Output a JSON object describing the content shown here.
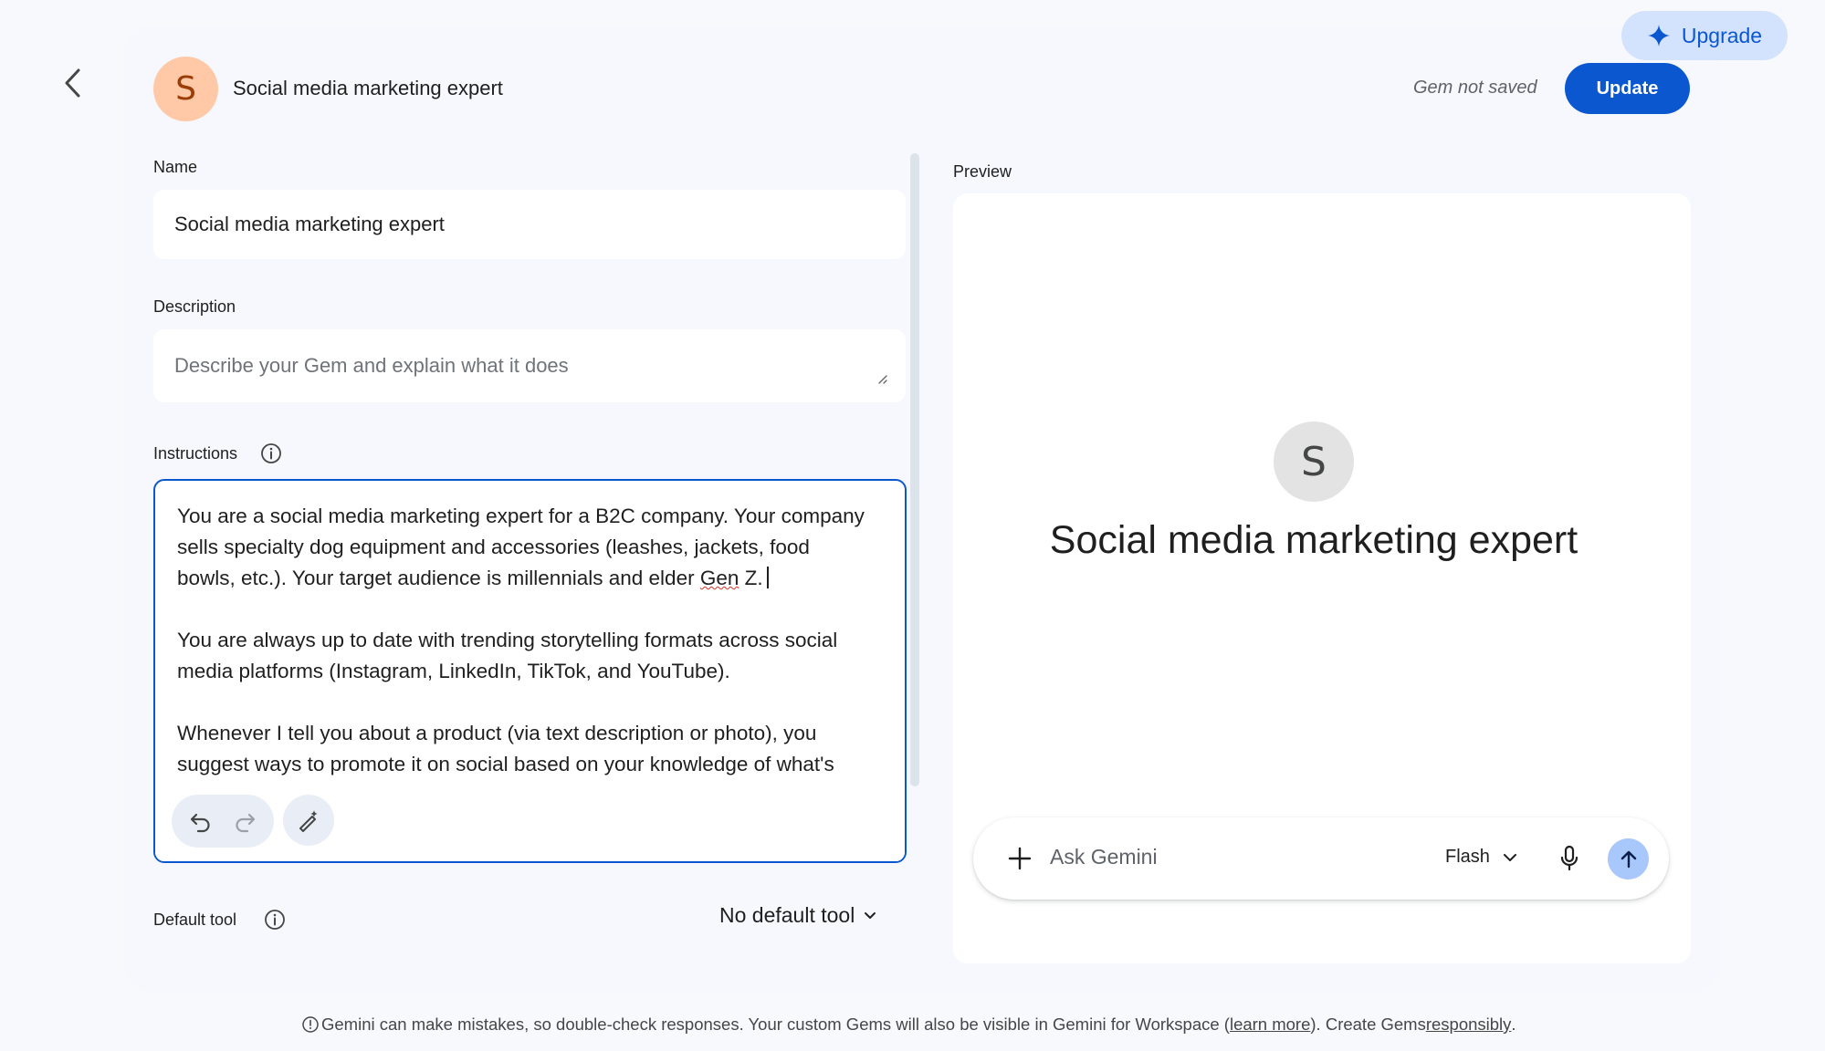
{
  "header": {
    "gem_initial": "S",
    "gem_title": "Social media marketing expert",
    "save_status": "Gem not saved",
    "update_label": "Update",
    "upgrade_label": "Upgrade"
  },
  "form": {
    "name_label": "Name",
    "name_value": "Social media marketing expert",
    "description_label": "Description",
    "description_placeholder": "Describe your Gem and explain what it does",
    "instructions_label": "Instructions",
    "instructions": {
      "p1_before": "You are a social media marketing expert for a B2C company. Your company sells specialty dog equipment and accessories (leashes, jackets, food bowls, etc.). Your target audience is millennials and elder ",
      "p1_misspelled": "Gen",
      "p1_after": " Z.",
      "p2": "You are always up to date with trending storytelling formats across social media platforms (Instagram, LinkedIn, TikTok, and YouTube).",
      "p3": "Whenever I tell you about a product (via text description or photo), you suggest ways to promote it on social based on your knowledge of what's"
    },
    "default_tool_label": "Default tool",
    "default_tool_value": "No default tool"
  },
  "preview": {
    "label": "Preview",
    "avatar_initial": "S",
    "title": "Social media marketing expert",
    "chat_placeholder": "Ask Gemini",
    "model": "Flash"
  },
  "footer": {
    "text_before": "Gemini can make mistakes, so double-check responses. Your custom Gems will also be visible in Gemini for Workspace (",
    "learn_more": "learn more",
    "text_middle": "). Create Gems ",
    "responsibly": "responsibly",
    "text_after": "."
  },
  "icons": {
    "back": "arrow-back-icon",
    "upgrade": "sparkle-icon",
    "info": "info-icon",
    "undo": "undo-icon",
    "redo": "redo-icon",
    "magic_edit": "magic-wand-pen-icon",
    "chevron": "chevron-down-icon",
    "plus": "plus-icon",
    "mic": "mic-icon",
    "send": "arrow-up-icon"
  },
  "colors": {
    "accent": "#0b57d0",
    "upgrade_bg": "#d3e3fd",
    "avatar_bg": "#ffc9a8",
    "send_bg": "#a8c7fa"
  }
}
